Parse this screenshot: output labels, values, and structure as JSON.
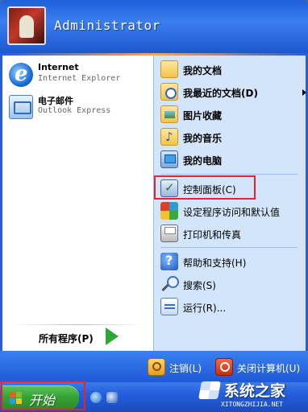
{
  "header": {
    "username": "Administrator"
  },
  "left": {
    "pinned": [
      {
        "title": "Internet",
        "subtitle": "Internet Explorer",
        "icon": "internet-explorer-icon"
      },
      {
        "title": "电子邮件",
        "subtitle": "Outlook Express",
        "icon": "outlook-express-icon"
      }
    ],
    "all_programs": "所有程序(P)"
  },
  "right": {
    "items": [
      {
        "label": "我的文档",
        "icon": "my-documents-icon"
      },
      {
        "label": "我最近的文档(D)",
        "icon": "recent-documents-icon"
      },
      {
        "label": "图片收藏",
        "icon": "my-pictures-icon"
      },
      {
        "label": "我的音乐",
        "icon": "my-music-icon"
      },
      {
        "label": "我的电脑",
        "icon": "my-computer-icon"
      },
      {
        "label": "控制面板(C)",
        "icon": "control-panel-icon"
      },
      {
        "label": "设定程序访问和默认值",
        "icon": "program-defaults-icon"
      },
      {
        "label": "打印机和传真",
        "icon": "printers-icon"
      },
      {
        "label": "帮助和支持(H)",
        "icon": "help-icon"
      },
      {
        "label": "搜索(S)",
        "icon": "search-icon"
      },
      {
        "label": "运行(R)...",
        "icon": "run-icon"
      }
    ]
  },
  "footer": {
    "logoff": "注销(L)",
    "shutdown": "关闭计算机(U)"
  },
  "taskbar": {
    "start": "开始"
  },
  "watermark": {
    "name": "系统之家",
    "url": "XITONGZHIJIA.NET"
  },
  "colors": {
    "highlight": "#e2252b",
    "start_green": "#37a335",
    "menu_blue": "#245edb"
  }
}
